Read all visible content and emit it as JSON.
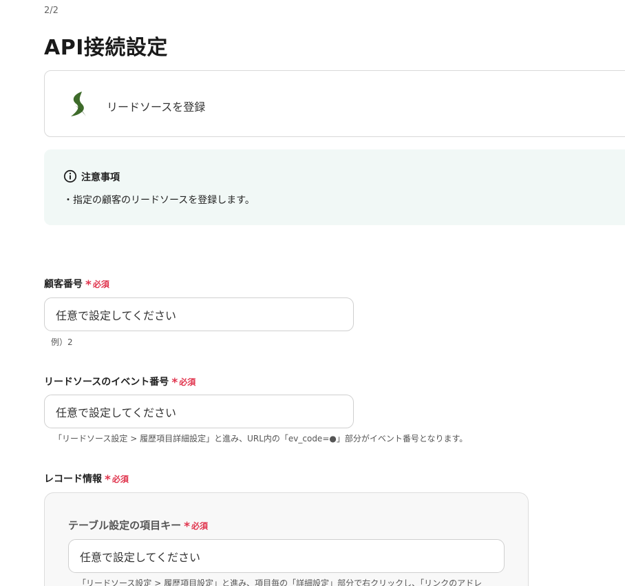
{
  "step": "2/2",
  "page_title": "API接続設定",
  "app": {
    "action_label": "リードソースを登録",
    "logo_icon": "green-s-logo-icon",
    "logo_color": "#3e6b2a"
  },
  "notice": {
    "icon": "info-circle-icon",
    "title": "注意事項",
    "body": "・指定の顧客のリードソースを登録します。"
  },
  "required_star": "*",
  "required_text": "必須",
  "fields": {
    "customer_number": {
      "label": "顧客番号",
      "placeholder": "任意で設定してください",
      "hint": "例）2"
    },
    "event_number": {
      "label": "リードソースのイベント番号",
      "placeholder": "任意で設定してください",
      "hint": "「リードソース設定 > 履歴項目詳細設定」と進み、URL内の「ev_code=●」部分がイベント番号となります。"
    },
    "record_info": {
      "label": "レコード情報",
      "sub_field": {
        "label": "テーブル設定の項目キー",
        "placeholder": "任意で設定してください",
        "hint": "「リードソース設定 > 履歴項目設定」と進み、項目毎の「詳細設定」部分で右クリックし、「リンクのアドレ"
      }
    }
  },
  "colors": {
    "required": "#e0344d",
    "notice_bg": "#f1f8f6"
  }
}
